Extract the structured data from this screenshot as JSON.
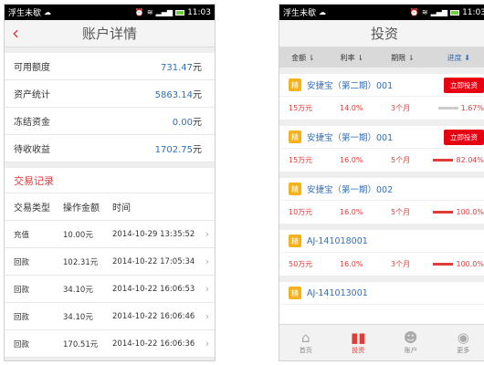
{
  "left": {
    "status": {
      "carrier": "浮生未歇",
      "time": "11:03"
    },
    "title": "账户详情",
    "summary": [
      {
        "label": "可用额度",
        "value": "731.47",
        "unit": "元"
      },
      {
        "label": "资产统计",
        "value": "5863.14",
        "unit": "元"
      },
      {
        "label": "冻结资金",
        "value": "0.00",
        "unit": "元"
      },
      {
        "label": "待收收益",
        "value": "1702.75",
        "unit": "元"
      }
    ],
    "records_title": "交易记录",
    "columns": [
      "交易类型",
      "操作金额",
      "时间"
    ],
    "records": [
      {
        "type": "充值",
        "amount": "10.00元",
        "time": "2014-10-29 13:35:52"
      },
      {
        "type": "回款",
        "amount": "102.31元",
        "time": "2014-10-22 17:05:34"
      },
      {
        "type": "回款",
        "amount": "34.10元",
        "time": "2014-10-22 16:06:53"
      },
      {
        "type": "回款",
        "amount": "34.10元",
        "time": "2014-10-22 16:06:46"
      },
      {
        "type": "回款",
        "amount": "170.51元",
        "time": "2014-10-22 16:06:36"
      }
    ]
  },
  "right": {
    "status": {
      "carrier": "浮生未歇",
      "time": "11:03"
    },
    "title": "投资",
    "sort": [
      "金额",
      "利率",
      "期限",
      "进度"
    ],
    "invest_label": "立即投资",
    "badge": "精",
    "products": [
      {
        "name": "安捷宝（第二期）001",
        "amount": "15万元",
        "rate": "14.0%",
        "term": "3个月",
        "progress": "1.67%",
        "progress_value": 1.67,
        "button": true
      },
      {
        "name": "安捷宝（第一期）001",
        "amount": "15万元",
        "rate": "16.0%",
        "term": "5个月",
        "progress": "82.04%",
        "progress_value": 82.04,
        "button": true
      },
      {
        "name": "安捷宝（第一期）002",
        "amount": "10万元",
        "rate": "16.0%",
        "term": "5个月",
        "progress": "100.0%",
        "progress_value": 100.0,
        "button": false
      },
      {
        "name": "AJ-141018001",
        "amount": "50万元",
        "rate": "16.0%",
        "term": "3个月",
        "progress": "100.0%",
        "progress_value": 100.0,
        "button": false
      },
      {
        "name": "AJ-141013001",
        "amount": "",
        "rate": "",
        "term": "",
        "progress": "",
        "progress_value": 0,
        "button": false
      }
    ],
    "tabs": [
      {
        "label": "首页",
        "icon": "home-icon"
      },
      {
        "label": "投资",
        "icon": "chart-icon"
      },
      {
        "label": "账户",
        "icon": "user-icon"
      },
      {
        "label": "更多",
        "icon": "eye-icon"
      }
    ],
    "active_tab": 1
  }
}
